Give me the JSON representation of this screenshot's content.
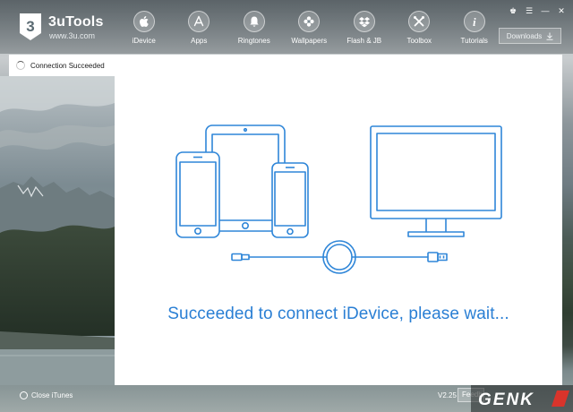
{
  "app": {
    "name": "3uTools",
    "site": "www.3u.com",
    "logo_text": "3"
  },
  "nav": [
    {
      "label": "iDevice",
      "icon": "apple-icon"
    },
    {
      "label": "Apps",
      "icon": "app-store-icon"
    },
    {
      "label": "Ringtones",
      "icon": "bell-icon"
    },
    {
      "label": "Wallpapers",
      "icon": "flower-icon"
    },
    {
      "label": "Flash & JB",
      "icon": "dropbox-icon"
    },
    {
      "label": "Toolbox",
      "icon": "tools-icon"
    },
    {
      "label": "Tutorials",
      "icon": "info-icon"
    }
  ],
  "window_controls": {
    "skin": "♚",
    "menu": "☰",
    "minimize": "—",
    "close": "✕"
  },
  "downloads": {
    "label": "Downloads",
    "icon": "download-icon"
  },
  "sidebar": {
    "status": "Connection Succeeded"
  },
  "main": {
    "status_text": "Succeeded to connect iDevice, please wait..."
  },
  "bottom": {
    "close_itunes": "Close iTunes",
    "version": "V2.25",
    "feedback": "Feedback"
  },
  "watermark": {
    "text": "GENK"
  },
  "colors": {
    "accent": "#2a7fd4",
    "illustration_stroke": "#2f86d8"
  }
}
